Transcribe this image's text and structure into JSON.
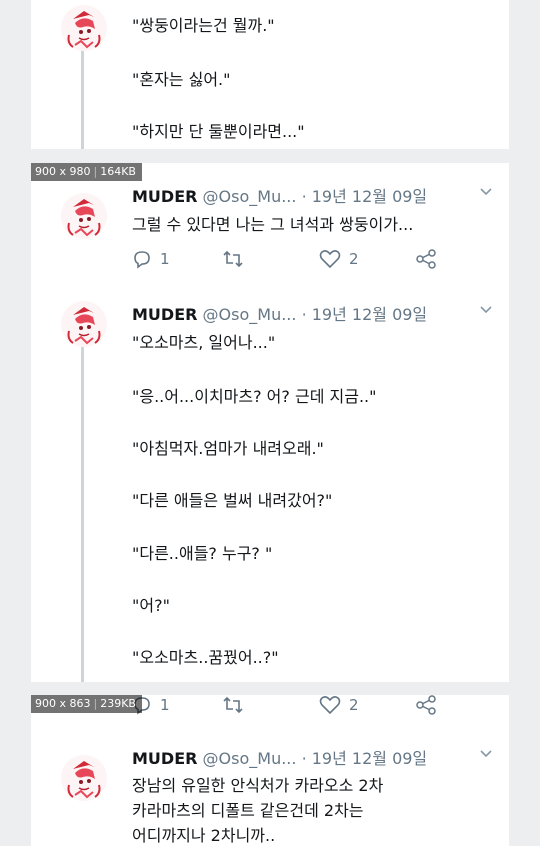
{
  "tweet1": {
    "lines": [
      "\"쌍둥이라는건 뭘까.\"",
      "\"혼자는 싫어.\"",
      "\"하지만 단 둘뿐이라면...\""
    ]
  },
  "badge1": {
    "size": "900 x 980",
    "bytes": "164KB"
  },
  "tweet2": {
    "name": "MUDER",
    "handle": "@Oso_Mu...",
    "date": "· 19년 12월 09일",
    "text": "그럴 수 있다면 나는 그 녀석과 쌍둥이가...",
    "replies": "1",
    "retweets": "",
    "likes": "2"
  },
  "tweet3": {
    "name": "MUDER",
    "handle": "@Oso_Mu...",
    "date": "· 19년 12월 09일",
    "lines": [
      "\"오소마츠, 일어나...\"",
      "\"응..어...이치마츠? 어? 근데 지금..\"",
      "\"아침먹자.엄마가 내려오래.\"",
      "\"다른 애들은 벌써 내려갔어?\"",
      "\"다른..애들? 누구? \"",
      "\"어?\"",
      "\"오소마츠..꿈꿨어..?\""
    ],
    "replies": "1",
    "likes": "2"
  },
  "badge2": {
    "size": "900 x 863",
    "bytes": "239KB"
  },
  "tweet4": {
    "name": "MUDER",
    "handle": "@Oso_Mu...",
    "date": "· 19년 12월 09일",
    "lines": [
      "장남의 유일한 안식처가 카라오소 2차",
      "카라마츠의 디폴트 같은건데 2차는",
      "어디까지나 2차니까.."
    ]
  },
  "icons": {
    "avatar": "avatar-icon",
    "chevron": "chevron-down-icon",
    "reply": "reply-icon",
    "retweet": "retweet-icon",
    "like": "heart-icon",
    "share": "share-icon"
  },
  "colors": {
    "name": "#14171a",
    "meta": "#657786",
    "thread": "#cdd4da",
    "background": "#eceeef"
  }
}
